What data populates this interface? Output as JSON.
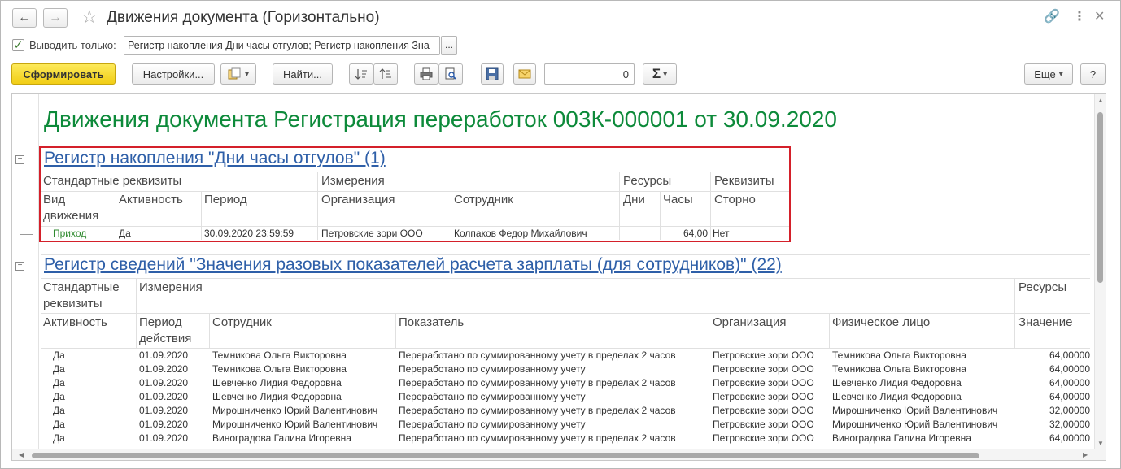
{
  "window": {
    "title": "Движения документа (Горизонтально)",
    "back_icon": "←",
    "forward_icon": "→",
    "star_icon": "☆",
    "link_icon": "🔗",
    "more_icon": "⋮",
    "close_icon": "✕"
  },
  "filter": {
    "checkbox_mark": "✓",
    "label": "Выводить только:",
    "value": "Регистр накопления Дни часы отгулов; Регистр накопления Зна",
    "dots_label": "..."
  },
  "toolbar": {
    "generate_label": "Сформировать",
    "settings_label": "Настройки...",
    "find_label": "Найти...",
    "number_value": "0",
    "more_label": "Еще",
    "help_label": "?",
    "sigma_label": "Σ",
    "dropdown_arrow": "▾"
  },
  "report": {
    "title": "Движения документа Регистрация переработок 003К-000001 от 30.09.2020",
    "sections": [
      {
        "title": "Регистр накопления \"Дни часы отгулов\" (1)",
        "groups": [
          "Стандартные реквизиты",
          "Измерения",
          "Ресурсы",
          "Реквизиты"
        ],
        "columns": [
          "Вид движения",
          "Активность",
          "Период",
          "Организация",
          "Сотрудник",
          "Дни",
          "Часы",
          "Сторно"
        ],
        "column_line1": [
          "Вид",
          "Активность",
          "Период",
          "Организация",
          "Сотрудник",
          "Дни",
          "Часы",
          "Сторно"
        ],
        "column_line2": [
          "движения",
          "",
          "",
          "",
          "",
          "",
          "",
          ""
        ],
        "rows": [
          [
            "Приход",
            "Да",
            "30.09.2020 23:59:59",
            "Петровские зори ООО",
            "Колпаков Федор Михайлович",
            "",
            "64,00",
            "Нет"
          ]
        ]
      },
      {
        "title": "Регистр сведений \"Значения разовых показателей расчета зарплаты (для сотрудников)\" (22)",
        "group_line1": [
          "Стандартные",
          "Измерения",
          "Ресурсы"
        ],
        "group_line2": [
          "реквизиты",
          "",
          ""
        ],
        "column_line1": [
          "Активность",
          "Период",
          "Сотрудник",
          "Показатель",
          "Организация",
          "Физическое лицо",
          "Значение"
        ],
        "column_line2": [
          "",
          "действия",
          "",
          "",
          "",
          "",
          ""
        ],
        "rows": [
          [
            "Да",
            "01.09.2020",
            "Темникова Ольга Викторовна",
            "Переработано по суммированному учету в пределах 2 часов",
            "Петровские зори ООО",
            "Темникова Ольга Викторовна",
            "64,00000"
          ],
          [
            "Да",
            "01.09.2020",
            "Темникова Ольга Викторовна",
            "Переработано по суммированному учету",
            "Петровские зори ООО",
            "Темникова Ольга Викторовна",
            "64,00000"
          ],
          [
            "Да",
            "01.09.2020",
            "Шевченко Лидия Федоровна",
            "Переработано по суммированному учету в пределах 2 часов",
            "Петровские зори ООО",
            "Шевченко Лидия Федоровна",
            "64,00000"
          ],
          [
            "Да",
            "01.09.2020",
            "Шевченко Лидия Федоровна",
            "Переработано по суммированному учету",
            "Петровские зори ООО",
            "Шевченко Лидия Федоровна",
            "64,00000"
          ],
          [
            "Да",
            "01.09.2020",
            "Мирошниченко Юрий Валентинович",
            "Переработано по суммированному учету в пределах 2 часов",
            "Петровские зори ООО",
            "Мирошниченко Юрий Валентинович",
            "32,00000"
          ],
          [
            "Да",
            "01.09.2020",
            "Мирошниченко Юрий Валентинович",
            "Переработано по суммированному учету",
            "Петровские зори ООО",
            "Мирошниченко Юрий Валентинович",
            "32,00000"
          ],
          [
            "Да",
            "01.09.2020",
            "Виноградова Галина Игоревна",
            "Переработано по суммированному учету в пределах 2 часов",
            "Петровские зори ООО",
            "Виноградова Галина Игоревна",
            "64,00000"
          ]
        ]
      }
    ]
  },
  "colors": {
    "title_green": "#0d8a3a",
    "link_blue": "#2e5fa8",
    "highlight_red": "#d4202a",
    "primary_yellow": "#f1cd16",
    "movement_green": "#2f8a2f"
  }
}
